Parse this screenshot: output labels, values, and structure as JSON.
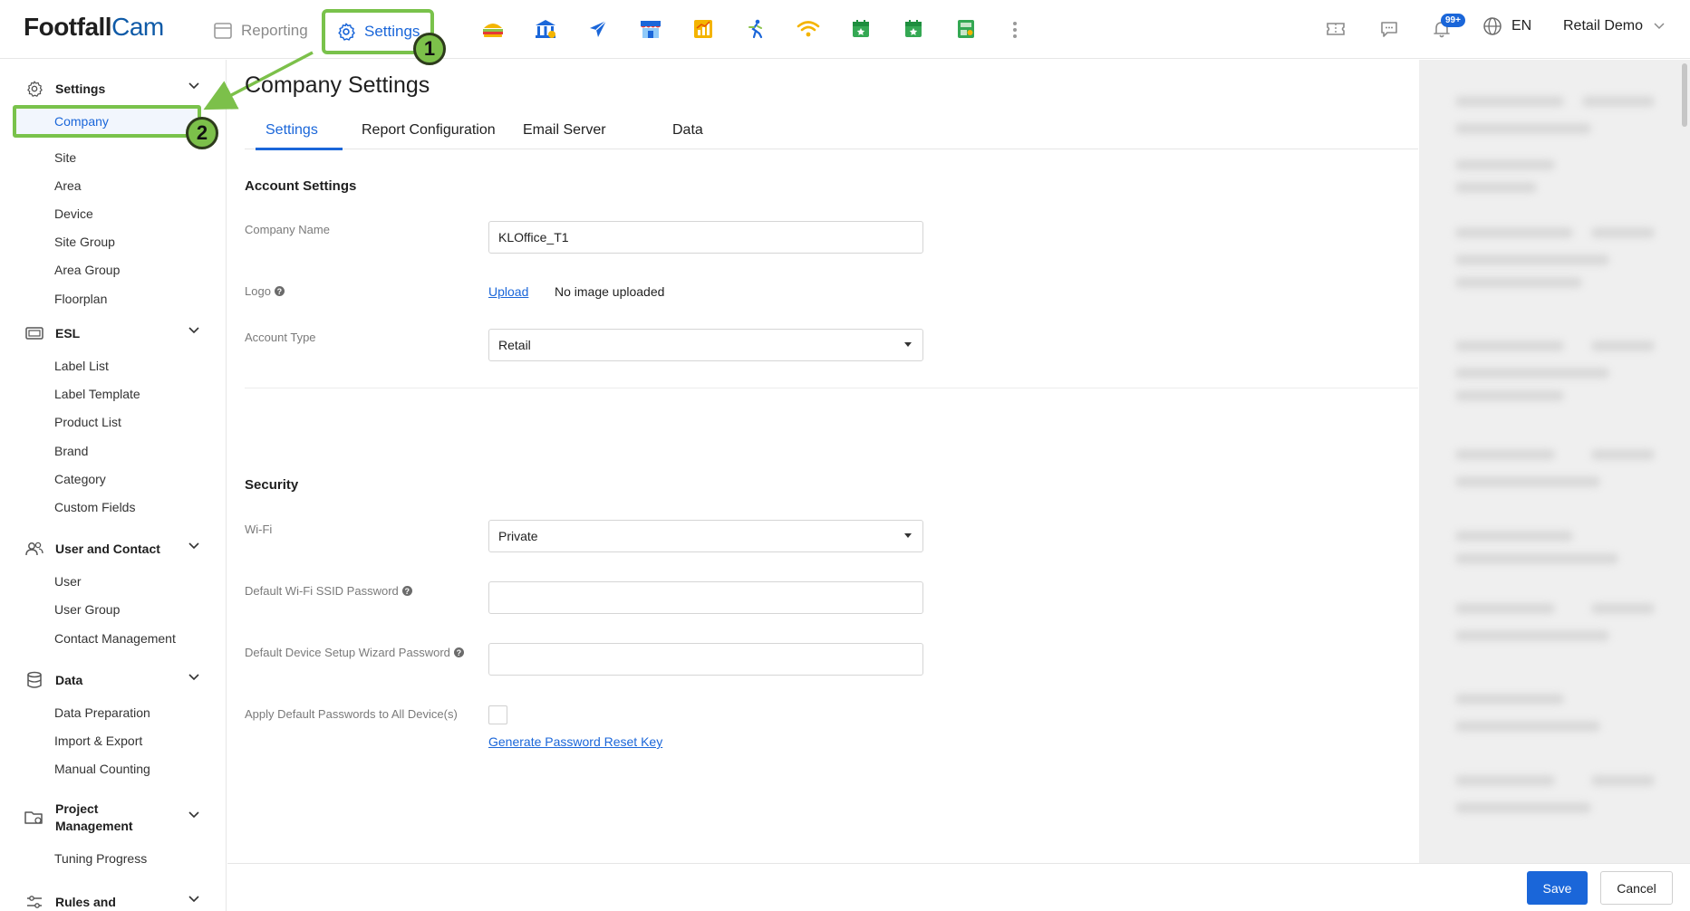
{
  "header": {
    "logo_bold": "Footfall",
    "logo_light": "Cam",
    "nav": {
      "reporting": "Reporting",
      "settings": "Settings"
    },
    "step_badges": [
      "1",
      "2"
    ],
    "app_icons": [
      "sandwich-icon",
      "bank-icon",
      "airplane-icon",
      "store-icon",
      "chart-icon",
      "running-person-icon",
      "wifi-icon",
      "calendar-icon",
      "calendar-icon",
      "cash-icon"
    ],
    "notification_count": "99+",
    "language": "EN",
    "user": "Retail Demo"
  },
  "sidebar": {
    "settings": {
      "title": "Settings",
      "items": [
        "Company",
        "Site",
        "Area",
        "Device",
        "Site Group",
        "Area Group",
        "Floorplan"
      ]
    },
    "esl": {
      "title": "ESL",
      "items": [
        "Label List",
        "Label Template",
        "Product List",
        "Brand",
        "Category",
        "Custom Fields"
      ]
    },
    "user_contact": {
      "title": "User and Contact",
      "items": [
        "User",
        "User Group",
        "Contact Management"
      ]
    },
    "data": {
      "title": "Data",
      "items": [
        "Data Preparation",
        "Import & Export",
        "Manual Counting"
      ]
    },
    "project": {
      "title_line1": "Project",
      "title_line2": "Management",
      "items": [
        "Tuning Progress"
      ]
    },
    "rules": {
      "title": "Rules and"
    }
  },
  "page": {
    "title": "Company Settings",
    "tabs": [
      "Settings",
      "Report Configuration",
      "Email Server",
      "Data"
    ],
    "account": {
      "title": "Account Settings",
      "company_name_label": "Company Name",
      "company_name_value": "KLOffice_T1",
      "logo_label": "Logo",
      "upload_link": "Upload",
      "no_image": "No image uploaded",
      "account_type_label": "Account Type",
      "account_type_value": "Retail"
    },
    "security": {
      "title": "Security",
      "wifi_label": "Wi-Fi",
      "wifi_value": "Private",
      "ssid_label": "Default Wi-Fi SSID Password",
      "wizard_label": "Default Device Setup Wizard Password",
      "apply_label": "Apply Default Passwords to All Device(s)",
      "reset_link": "Generate Password Reset Key"
    }
  },
  "footer": {
    "save": "Save",
    "cancel": "Cancel"
  },
  "colors": {
    "accent": "#1a66d9",
    "highlight": "#79c24b",
    "badge": "#7cc04a"
  }
}
